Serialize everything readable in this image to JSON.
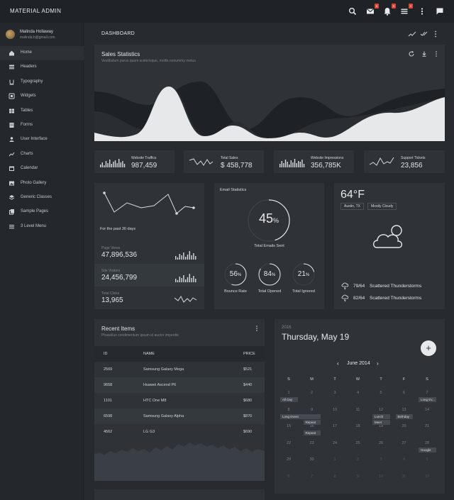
{
  "header": {
    "brand": "MATERIAL ADMIN",
    "icons": [
      {
        "name": "search-icon",
        "badge": ""
      },
      {
        "name": "mail-icon",
        "badge": "5"
      },
      {
        "name": "bell-icon",
        "badge": "9"
      },
      {
        "name": "tasks-icon",
        "badge": "2"
      },
      {
        "name": "more-vert-icon",
        "badge": ""
      },
      {
        "name": "chat-icon",
        "badge": ""
      }
    ]
  },
  "profile": {
    "name": "Malinda Hollaway",
    "email": "malinda.h@gmail.com"
  },
  "sidebar": {
    "items": [
      {
        "label": "Home",
        "icon": "home-icon",
        "active": true
      },
      {
        "label": "Headers",
        "icon": "header-icon"
      },
      {
        "label": "Typography",
        "icon": "typography-icon"
      },
      {
        "label": "Widgets",
        "icon": "widgets-icon"
      },
      {
        "label": "Tables",
        "icon": "tables-icon"
      },
      {
        "label": "Forms",
        "icon": "forms-icon"
      },
      {
        "label": "User Interface",
        "icon": "ui-icon"
      },
      {
        "label": "Charts",
        "icon": "charts-icon"
      },
      {
        "label": "Calendar",
        "icon": "calendar-icon"
      },
      {
        "label": "Photo Gallery",
        "icon": "photo-icon"
      },
      {
        "label": "Generic Classes",
        "icon": "layers-icon"
      },
      {
        "label": "Sample Pages",
        "icon": "pages-icon"
      },
      {
        "label": "3 Level Menu",
        "icon": "menu-icon"
      }
    ]
  },
  "dashboard": {
    "title": "DASHBOARD"
  },
  "sales": {
    "title": "Sales Statistics",
    "subtitle": "Vestibulum purus quam scelerisque, mollis nonummy metus"
  },
  "stats": [
    {
      "label": "Website Traffics",
      "value": "987,459"
    },
    {
      "label": "Total Sales",
      "value": "$ 458,778"
    },
    {
      "label": "Website Impressions",
      "value": "356,785K"
    },
    {
      "label": "Support Tickets",
      "value": "23,856"
    }
  ],
  "traffic": {
    "caption": "For the past 30 days",
    "rows": [
      {
        "label": "Page Views",
        "value": "47,896,536"
      },
      {
        "label": "Site Visitors",
        "value": "24,456,799"
      },
      {
        "label": "Total Clicks",
        "value": "13,965"
      }
    ]
  },
  "email": {
    "title": "Email Statistics",
    "main": {
      "value": "45",
      "unit": "%",
      "label": "Total Emails Sent",
      "pct": 45
    },
    "small": [
      {
        "value": "56",
        "unit": "%",
        "label": "Bounce Rate",
        "pct": 56
      },
      {
        "value": "84",
        "unit": "%",
        "label": "Total Opened",
        "pct": 84
      },
      {
        "value": "21",
        "unit": "%",
        "label": "Total Ignored",
        "pct": 21
      }
    ]
  },
  "weather": {
    "temp": "64°F",
    "location": "Austin, TX",
    "condition": "Mostly Cloudy",
    "forecast": [
      {
        "range": "79/64",
        "desc": "Scattered Thunderstorms"
      },
      {
        "range": "82/64",
        "desc": "Scattered Thunderstorms"
      }
    ]
  },
  "recent": {
    "title": "Recent Items",
    "subtitle": "Phasellus condimentum ipsum id auctor imperdie",
    "columns": [
      "ID",
      "NAME",
      "PRICE"
    ],
    "rows": [
      {
        "id": "2569",
        "name": "Samsung Galaxy Mega",
        "price": "$521"
      },
      {
        "id": "9658",
        "name": "Huawei Ascend P6",
        "price": "$440"
      },
      {
        "id": "1101",
        "name": "HTC One M8",
        "price": "$680"
      },
      {
        "id": "6598",
        "name": "Samsung Galaxy Alpha",
        "price": "$870"
      },
      {
        "id": "4562",
        "name": "LG G3",
        "price": "$690"
      }
    ]
  },
  "calendar": {
    "year": "2016",
    "date": "Thursday, May 19",
    "month": "June 2014",
    "weekdays": [
      "S",
      "M",
      "T",
      "W",
      "T",
      "F",
      "S"
    ],
    "weeks": [
      [
        "1",
        "2",
        "3",
        "4",
        "5",
        "6",
        "7"
      ],
      [
        "8",
        "9",
        "10",
        "11",
        "12",
        "13",
        "14"
      ],
      [
        "15",
        "16",
        "17",
        "18",
        "19",
        "20",
        "21"
      ],
      [
        "22",
        "23",
        "24",
        "25",
        "26",
        "27",
        "28"
      ],
      [
        "29",
        "30",
        "1",
        "2",
        "3",
        "4",
        "5"
      ],
      [
        "6",
        "7",
        "8",
        "9",
        "10",
        "11",
        "12"
      ]
    ],
    "events": [
      {
        "label": "All Day",
        "week": 0,
        "day": 0,
        "slot": 0
      },
      {
        "label": "Long Ev...",
        "week": 0,
        "day": 6,
        "slot": 0
      },
      {
        "label": "Long Event",
        "week": 1,
        "day": 0,
        "slot": 0,
        "span": 2
      },
      {
        "label": "Repeat",
        "week": 1,
        "day": 1,
        "slot": 1
      },
      {
        "label": "Lunch",
        "week": 1,
        "day": 4,
        "slot": 0
      },
      {
        "label": "Birthday",
        "week": 1,
        "day": 5,
        "slot": 0
      },
      {
        "label": "Meet",
        "week": 1,
        "day": 4,
        "slot": 1
      },
      {
        "label": "Repeat",
        "week": 2,
        "day": 1,
        "slot": 0
      },
      {
        "label": "Google",
        "week": 3,
        "day": 6,
        "slot": 0
      }
    ]
  },
  "colors": {
    "accent": "#e8eaec",
    "badge": "#d34a3f",
    "panel": "#2f3338"
  }
}
